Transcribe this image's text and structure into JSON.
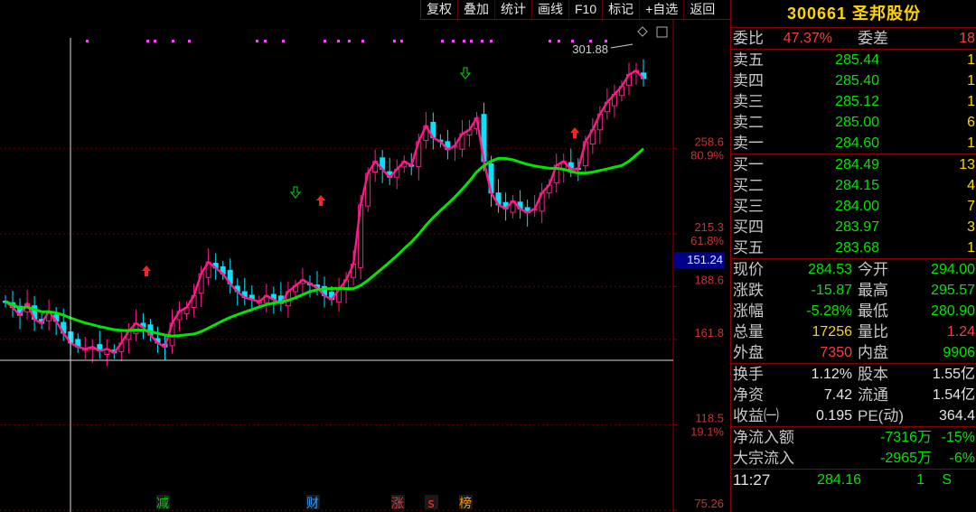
{
  "toolbar": {
    "buttons": [
      "复权",
      "叠加",
      "统计",
      "画线",
      "F10",
      "标记",
      "+自选",
      "返回"
    ]
  },
  "stock": {
    "code": "300661",
    "name": "圣邦股份"
  },
  "order_book": {
    "wei_bi_label": "委比",
    "wei_bi": "47.37%",
    "wei_cha_label": "委差",
    "wei_cha": "18",
    "sells": [
      {
        "label": "卖五",
        "price": "285.44",
        "vol": "1"
      },
      {
        "label": "卖四",
        "price": "285.40",
        "vol": "1"
      },
      {
        "label": "卖三",
        "price": "285.12",
        "vol": "1"
      },
      {
        "label": "卖二",
        "price": "285.00",
        "vol": "6"
      },
      {
        "label": "卖一",
        "price": "284.60",
        "vol": "1"
      }
    ],
    "buys": [
      {
        "label": "买一",
        "price": "284.49",
        "vol": "13"
      },
      {
        "label": "买二",
        "price": "284.15",
        "vol": "4"
      },
      {
        "label": "买三",
        "price": "284.00",
        "vol": "7"
      },
      {
        "label": "买四",
        "price": "283.97",
        "vol": "3"
      },
      {
        "label": "买五",
        "price": "283.68",
        "vol": "1"
      }
    ]
  },
  "quote": {
    "rows": [
      {
        "l1": "现价",
        "v1": "284.53",
        "c1": "green",
        "l2": "今开",
        "v2": "294.00",
        "c2": "green"
      },
      {
        "l1": "涨跌",
        "v1": "-15.87",
        "c1": "green",
        "l2": "最高",
        "v2": "295.57",
        "c2": "green"
      },
      {
        "l1": "涨幅",
        "v1": "-5.28%",
        "c1": "green",
        "l2": "最低",
        "v2": "280.90",
        "c2": "green"
      },
      {
        "l1": "总量",
        "v1": "17256",
        "c1": "yellow",
        "l2": "量比",
        "v2": "1.24",
        "c2": "red"
      },
      {
        "l1": "外盘",
        "v1": "7350",
        "c1": "red",
        "l2": "内盘",
        "v2": "9906",
        "c2": "green"
      }
    ]
  },
  "fundamentals": {
    "rows": [
      {
        "l1": "换手",
        "v1": "1.12%",
        "l2": "股本",
        "v2": "1.55亿"
      },
      {
        "l1": "净资",
        "v1": "7.42",
        "l2": "流通",
        "v2": "1.54亿"
      },
      {
        "l1": "收益㈠",
        "v1": "0.195",
        "l2": "PE(动)",
        "v2": "364.4"
      }
    ]
  },
  "flows": {
    "rows": [
      {
        "label": "净流入额",
        "v1": "-7316万",
        "v2": "-15%"
      },
      {
        "label": "大宗流入",
        "v1": "-2965万",
        "v2": "-6%"
      }
    ]
  },
  "tick": {
    "time": "11:27",
    "price": "284.16",
    "vol": "1",
    "side": "S"
  },
  "chart": {
    "high_label": "301.88",
    "crosshair_price": "151.24",
    "axis": [
      {
        "price": "258.6",
        "pct": "80.9%"
      },
      {
        "price": "215.3",
        "pct": "61.8%"
      },
      {
        "price": "188.6",
        "pct": ""
      },
      {
        "price": "161.8",
        "pct": ""
      },
      {
        "price": "118.5",
        "pct": "19.1%"
      },
      {
        "price": "75.26",
        "pct": ""
      }
    ],
    "markers": [
      {
        "text": "减",
        "color": "#00cc00"
      },
      {
        "text": "财",
        "color": "#3399ff"
      },
      {
        "text": "涨",
        "color": "#ff3030"
      },
      {
        "text": "s",
        "color": "#ff3030"
      },
      {
        "text": "榜",
        "color": "#ff9900"
      }
    ]
  },
  "colors": {
    "up": "#ff1a8c",
    "down": "#00e5ff",
    "ma": "#00e600",
    "frame": "#8b0000"
  },
  "chart_data": {
    "type": "candlestick",
    "ma_name": "",
    "price_range": [
      75.26,
      310
    ],
    "levels": [
      258.6,
      215.3,
      188.6,
      161.8,
      118.5,
      75.26
    ],
    "close": [
      181,
      178,
      174,
      180,
      172,
      170,
      176,
      171,
      165,
      160,
      158,
      157,
      158,
      156,
      157,
      155,
      160,
      166,
      170,
      168,
      164,
      160,
      158,
      170,
      176,
      178,
      184,
      195,
      201,
      198,
      195,
      190,
      186,
      183,
      182,
      181,
      184,
      182,
      180,
      186,
      189,
      192,
      190,
      188,
      184,
      182,
      187,
      192,
      200,
      230,
      246,
      252,
      248,
      244,
      248,
      252,
      250,
      262,
      270,
      264,
      262,
      258,
      260,
      266,
      268,
      274,
      252,
      236,
      230,
      228,
      232,
      228,
      226,
      228,
      236,
      240,
      250,
      252,
      248,
      248,
      262,
      268,
      276,
      282,
      286,
      290,
      296,
      298,
      294
    ]
  }
}
